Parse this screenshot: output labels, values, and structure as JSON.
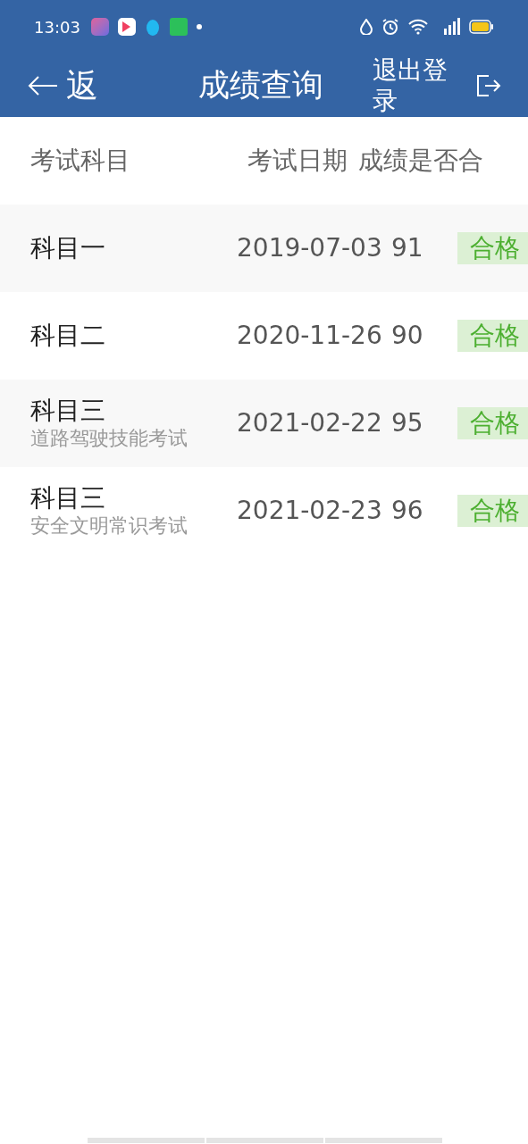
{
  "status_bar": {
    "time": "13:03"
  },
  "header": {
    "back": "返",
    "title": "成绩查询",
    "logout": "退出登录"
  },
  "table": {
    "columns": [
      "考试科目",
      "考试日期",
      "成绩是否合"
    ],
    "rows": [
      {
        "subject": "科目一",
        "date": "2019-07-03",
        "score": "91",
        "result": "合格",
        "passed": true
      },
      {
        "subject": "科目二",
        "date": "2020-11-26",
        "score": "90",
        "result": "合格",
        "passed": true
      },
      {
        "subject": "科目三",
        "subtitle": "道路驾驶技能考试",
        "date": "2021-02-22",
        "score": "95",
        "result": "合格",
        "passed": true
      },
      {
        "subject": "科目三",
        "subtitle": "安全文明常识考试",
        "date": "2021-02-23",
        "score": "96",
        "result": "合格",
        "passed": true
      }
    ]
  }
}
